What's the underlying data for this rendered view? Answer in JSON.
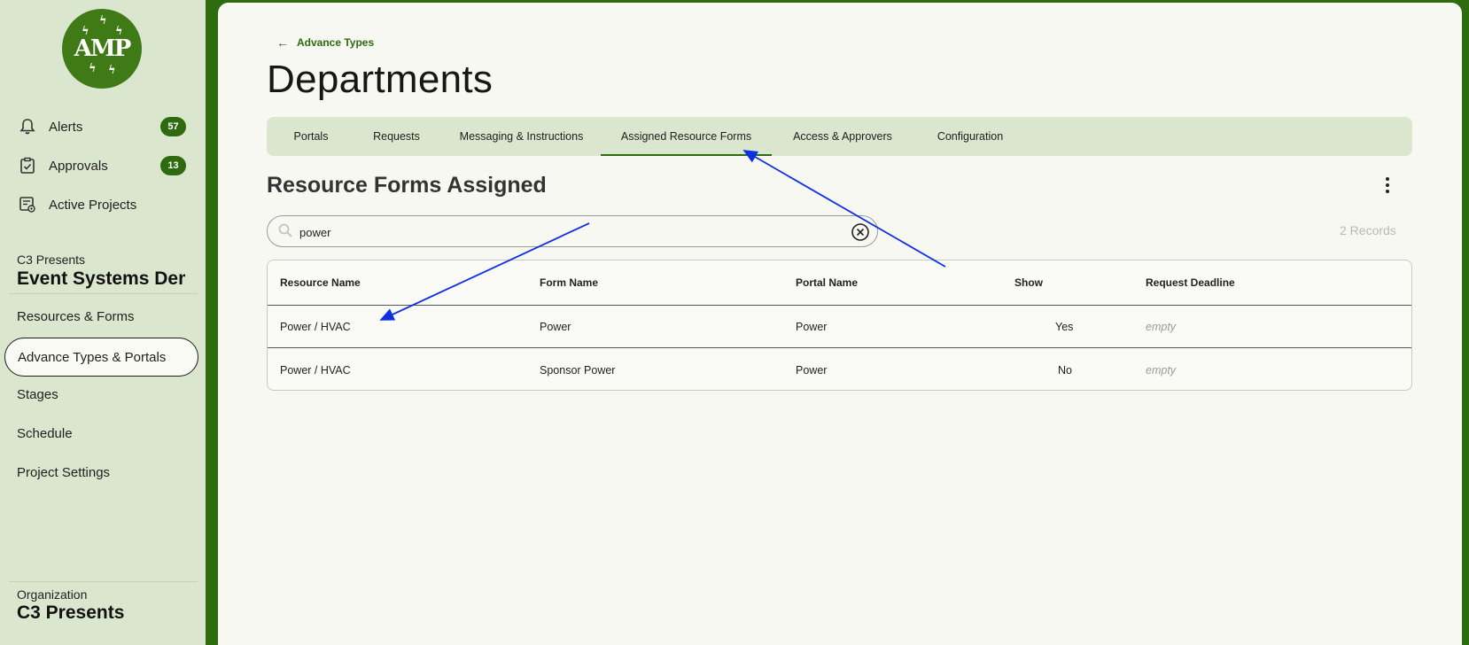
{
  "sidebar": {
    "logo_text": "AMP",
    "top_items": [
      {
        "label": "Alerts",
        "badge": "57",
        "icon": "bell-icon"
      },
      {
        "label": "Approvals",
        "badge": "13",
        "icon": "clipboard-check-icon"
      },
      {
        "label": "Active Projects",
        "badge": "",
        "icon": "projects-icon"
      }
    ],
    "project_org": "C3 Presents",
    "project_name": "Event Systems Demo",
    "items": [
      {
        "label": "Resources & Forms"
      },
      {
        "label": "Advance Types & Portals",
        "active": true
      },
      {
        "label": "Stages"
      },
      {
        "label": "Schedule"
      },
      {
        "label": "Project Settings"
      }
    ],
    "organization_label": "Organization",
    "organization_name": "C3 Presents"
  },
  "main": {
    "back_link": "Advance Types",
    "title": "Departments",
    "tabs": [
      {
        "label": "Portals"
      },
      {
        "label": "Requests"
      },
      {
        "label": "Messaging & Instructions"
      },
      {
        "label": "Assigned Resource Forms",
        "active": true
      },
      {
        "label": "Access & Approvers"
      },
      {
        "label": "Configuration"
      }
    ],
    "section_title": "Resource Forms Assigned",
    "search": {
      "value": "power",
      "placeholder": "Search"
    },
    "records": "2 Records",
    "table": {
      "headers": [
        "Resource Name",
        "Form Name",
        "Portal Name",
        "Show",
        "Request Deadline"
      ],
      "rows": [
        {
          "resource": "Power / HVAC",
          "form": "Power",
          "portal": "Power",
          "show": "Yes",
          "deadline": "empty"
        },
        {
          "resource": "Power / HVAC",
          "form": "Sponsor Power",
          "portal": "Power",
          "show": "No",
          "deadline": "empty"
        }
      ]
    }
  },
  "colors": {
    "brand_green": "#2e6b0f",
    "sidebar_bg": "#dbe6cf",
    "content_bg": "#f8f8f2",
    "annotation_arrow": "#1030e0"
  }
}
